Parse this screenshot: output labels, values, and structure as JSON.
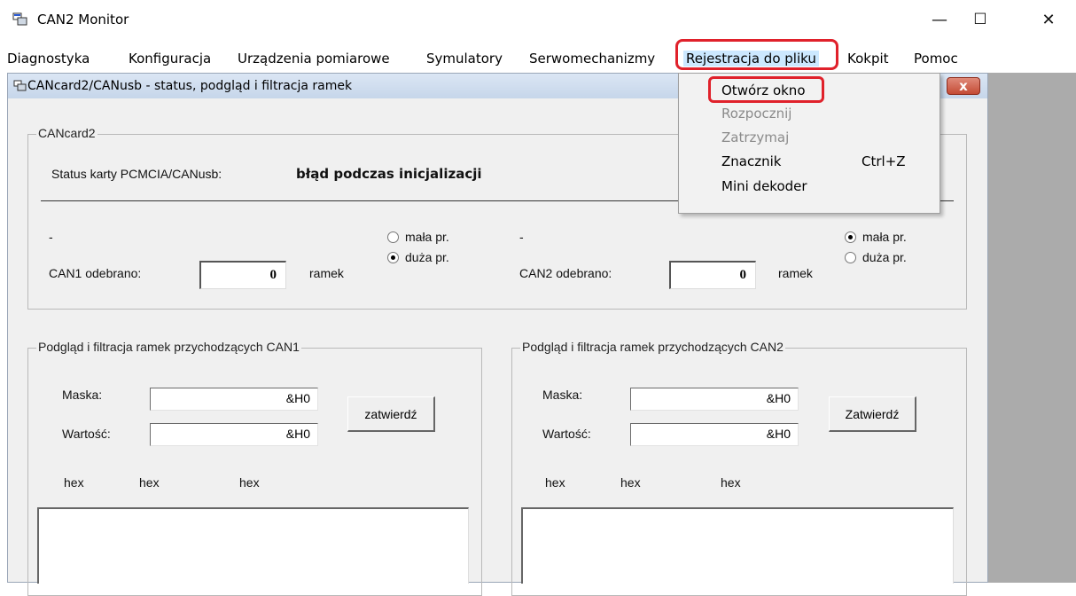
{
  "window": {
    "title": "CAN2 Monitor",
    "minimize": "—",
    "maximize": "☐",
    "close": "✕"
  },
  "menu": [
    {
      "label": "Diagnostyka"
    },
    {
      "label": "Konfiguracja"
    },
    {
      "label": "Urządzenia pomiarowe"
    },
    {
      "label": "Symulatory"
    },
    {
      "label": "Serwomechanizmy"
    },
    {
      "label": "Rejestracja do pliku"
    },
    {
      "label": "Kokpit"
    },
    {
      "label": "Pomoc"
    }
  ],
  "dropdown": {
    "items": [
      {
        "label": "Otwórz okno",
        "disabled": false
      },
      {
        "label": "Rozpocznij",
        "disabled": true
      },
      {
        "label": "Zatrzymaj",
        "disabled": true
      },
      {
        "label": "Znacznik",
        "shortcut": "Ctrl+Z",
        "disabled": false
      },
      {
        "label": "Mini dekoder",
        "disabled": false
      }
    ]
  },
  "child": {
    "title": "CANcard2/CANusb - status, podgląd i filtracja ramek",
    "close": "x"
  },
  "cancard": {
    "group_label": "CANcard2",
    "status_label": "Status karty PCMCIA/CANusb:",
    "status_value": "błąd podczas inicjalizacji",
    "can1": {
      "dash": "-",
      "received_label": "CAN1 odebrano:",
      "count": "0",
      "unit": "ramek",
      "radio_small": "mała pr.",
      "radio_large": "duża pr.",
      "selected": "large"
    },
    "can2": {
      "dash": "-",
      "received_label": "CAN2 odebrano:",
      "count": "0",
      "unit": "ramek",
      "radio_small": "mała pr.",
      "radio_large": "duża pr.",
      "selected": "small"
    }
  },
  "filter1": {
    "group_label": "Podgląd i filtracja ramek przychodzących CAN1",
    "mask_label": "Maska:",
    "mask_value": "&H0",
    "value_label": "Wartość:",
    "value_value": "&H0",
    "button": "zatwierdź",
    "hex": [
      "hex",
      "hex",
      "hex"
    ]
  },
  "filter2": {
    "group_label": "Podgląd i filtracja ramek przychodzących CAN2",
    "mask_label": "Maska:",
    "mask_value": "&H0",
    "value_label": "Wartość:",
    "value_value": "&H0",
    "button": "Zatwierdź",
    "hex": [
      "hex",
      "hex",
      "hex"
    ]
  },
  "colors": {
    "highlight": "#e0212b",
    "menu_open": "#cce8ff",
    "mdi_background": "#ababab",
    "dialog_background": "#f0f0f0"
  }
}
